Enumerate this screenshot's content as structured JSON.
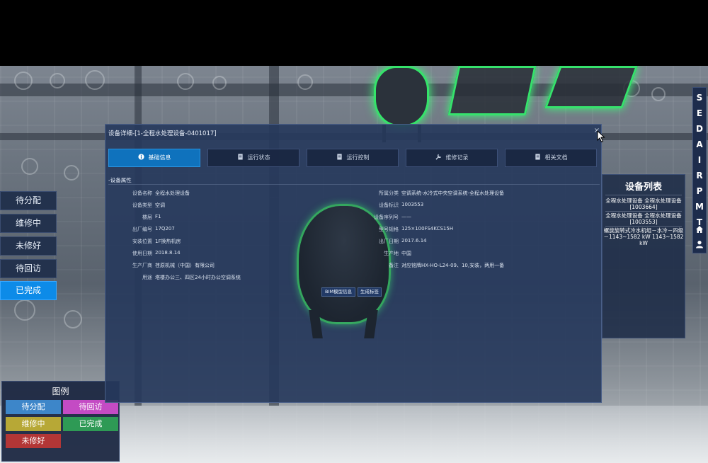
{
  "status_buttons": [
    {
      "label": "待分配",
      "active": false
    },
    {
      "label": "维修中",
      "active": false
    },
    {
      "label": "未修好",
      "active": false
    },
    {
      "label": "待回访",
      "active": false
    },
    {
      "label": "已完成",
      "active": true
    }
  ],
  "legend": {
    "title": "图例",
    "items": [
      {
        "label": "待分配",
        "color": "#3d86c9"
      },
      {
        "label": "待回访",
        "color": "#c44bc4"
      },
      {
        "label": "维修中",
        "color": "#b7a836"
      },
      {
        "label": "已完成",
        "color": "#2e9a55"
      },
      {
        "label": "未修好",
        "color": "#b33636"
      }
    ]
  },
  "vnav": {
    "letters": [
      "S",
      "E",
      "D",
      "A",
      "I",
      "R",
      "P",
      "M",
      "T"
    ],
    "icons": [
      "home-icon",
      "user-icon"
    ]
  },
  "device_list": {
    "title": "设备列表",
    "items": [
      {
        "line1": "全程水处理设备 全程水处理设备",
        "line2": "[1003664]"
      },
      {
        "line1": "全程水处理设备 全程水处理设备",
        "line2": "[1003553]"
      },
      {
        "line1": "螺旋旋转式冷水机组－水冷－四级",
        "line2": "－1143~1582 kW 1143~1582 kW"
      }
    ]
  },
  "dialog": {
    "title": "设备详细-[1-全程水处理设备-0401017]",
    "close": "×",
    "tabs": [
      {
        "label": "基础信息",
        "icon": "info-icon",
        "active": true
      },
      {
        "label": "运行状态",
        "icon": "document-icon",
        "active": false
      },
      {
        "label": "运行控制",
        "icon": "document-icon",
        "active": false
      },
      {
        "label": "维修记录",
        "icon": "wrench-icon",
        "active": false
      },
      {
        "label": "相关文档",
        "icon": "document-icon",
        "active": false
      }
    ],
    "section": "-设备属性",
    "left_fields": [
      {
        "label": "设备名称",
        "value": "全程水处理设备"
      },
      {
        "label": "设备类型",
        "value": "空调"
      },
      {
        "label": "楼层",
        "value": "F1"
      },
      {
        "label": "出厂编号",
        "value": "17Q207"
      },
      {
        "label": "安装位置",
        "value": "1F换热机房"
      },
      {
        "label": "使用日期",
        "value": "2018.8.14"
      },
      {
        "label": "生产厂商",
        "value": "荏原机械（中国）有限公司"
      },
      {
        "label": "用途",
        "value": "塔楼办公三、四区24小时办公空调系统"
      }
    ],
    "right_fields": [
      {
        "label": "所属分类",
        "value": "空调系统-水冷式中央空调系统-全程水处理设备"
      },
      {
        "label": "设备标识",
        "value": "1003553"
      },
      {
        "label": "设备序列号",
        "value": "——"
      },
      {
        "label": "型号规格",
        "value": "125×100FS4KCS15H"
      },
      {
        "label": "出厂日期",
        "value": "2017.6.14"
      },
      {
        "label": "生产地",
        "value": "中国"
      },
      {
        "label": "备注",
        "value": "对应铭牌HX-HO-L24-09、10,安装，两用一备"
      }
    ],
    "buttons": [
      {
        "label": "BIM模型信息"
      },
      {
        "label": "生成标签"
      }
    ]
  }
}
